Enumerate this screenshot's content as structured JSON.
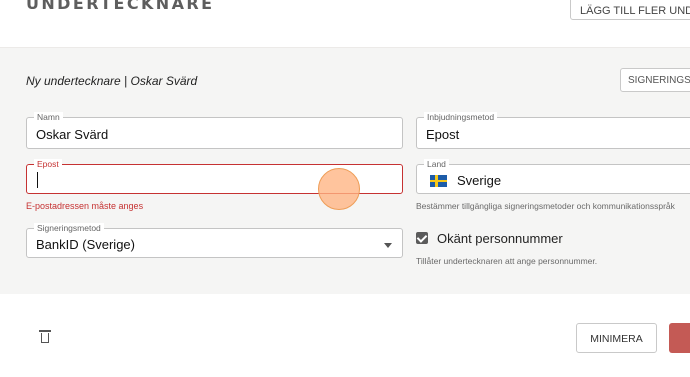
{
  "header": {
    "title": "UNDERTECKNARE",
    "add_more_label": "LÄGG TILL FLER UNDERTECKNARE"
  },
  "signer": {
    "subtitle": "Ny undertecknare | Oskar Svärd",
    "signing_button_label": "SIGNERINGSORDNING"
  },
  "form": {
    "name": {
      "label": "Namn",
      "value": "Oskar Svärd"
    },
    "email": {
      "label": "Epost",
      "value": "",
      "error": "E-postadressen måste anges"
    },
    "signing_method": {
      "label": "Signeringsmetod",
      "value": "BankID (Sverige)"
    },
    "invite_method": {
      "label": "Inbjudningsmetod",
      "value": "Epost"
    },
    "country": {
      "label": "Land",
      "value": "Sverige",
      "hint": "Bestämmer tillgängliga signeringsmetoder och kommunikationsspråk"
    },
    "unknown_ssn": {
      "label": "Okänt personnummer",
      "checked": true,
      "hint": "Tillåter undertecknaren att ange personnummer."
    }
  },
  "footer": {
    "minimize_label": "MINIMERA"
  },
  "colors": {
    "error": "#c63232",
    "card_bg": "#f5f5f4",
    "accent_red": "#c45a55"
  },
  "icons": {
    "delete": "trash-icon",
    "country_flag": "sweden-flag-icon",
    "dropdown": "chevron-down-icon"
  }
}
